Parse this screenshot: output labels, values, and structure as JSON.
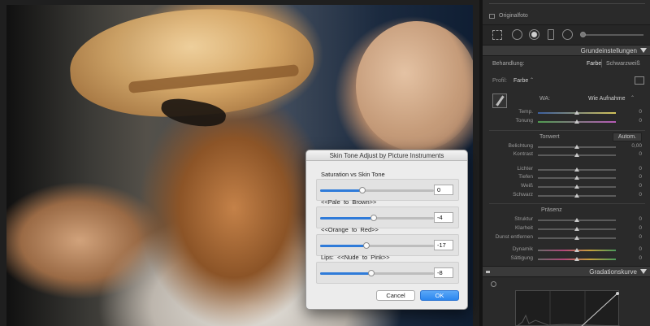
{
  "dialog": {
    "title": "Skin Tone Adjust by Picture Instruments",
    "sliders": [
      {
        "label": "Saturation vs Skin Tone",
        "value": "0",
        "position": 0.37
      },
      {
        "label": "<<Pale  to  Brown>>",
        "value": "-4",
        "position": 0.47
      },
      {
        "label": "<<Orange  to  Red>>",
        "value": "-17",
        "position": 0.41
      },
      {
        "label": "Lips:  <<Nude  to  Pink>>",
        "value": "-8",
        "position": 0.45
      }
    ],
    "cancel_label": "Cancel",
    "ok_label": "OK"
  },
  "panel": {
    "original_photo_label": "Originalfoto",
    "basic_header": "Grundeinstellungen",
    "treatment_label": "Behandlung:",
    "treatment_color": "Farbe",
    "treatment_bw": "Schwarzweiß",
    "profile_label": "Profil:",
    "profile_value": "Farbe",
    "wb_label": "WA:",
    "wb_value": "Wie Aufnahme",
    "temp": {
      "label": "Temp.",
      "value": "0",
      "position": 0.5
    },
    "tint": {
      "label": "Tonung",
      "value": "0",
      "position": 0.5
    },
    "tone_label": "Tonwert",
    "auto_label": "Autom.",
    "exposure": {
      "label": "Belichtung",
      "value": "0,00",
      "position": 0.5
    },
    "contrast": {
      "label": "Kontrast",
      "value": "0",
      "position": 0.5
    },
    "highlights": {
      "label": "Lichter",
      "value": "0",
      "position": 0.5
    },
    "shadows": {
      "label": "Tiefen",
      "value": "0",
      "position": 0.5
    },
    "whites": {
      "label": "Weiß",
      "value": "0",
      "position": 0.5
    },
    "blacks": {
      "label": "Schwarz",
      "value": "0",
      "position": 0.5
    },
    "presence_label": "Präsenz",
    "texture": {
      "label": "Struktur",
      "value": "0",
      "position": 0.5
    },
    "clarity": {
      "label": "Klarheit",
      "value": "0",
      "position": 0.5
    },
    "dehaze": {
      "label": "Dunst entfernen",
      "value": "0",
      "position": 0.5
    },
    "vibrance": {
      "label": "Dynamik",
      "value": "0",
      "position": 0.5
    },
    "saturation": {
      "label": "Sättigung",
      "value": "0",
      "position": 0.5
    },
    "curve_header": "Gradationskurve"
  },
  "colors": {
    "accent": "#2f7bd9",
    "panel_bg": "#2a2a2a",
    "dialog_bg": "#ececec"
  }
}
